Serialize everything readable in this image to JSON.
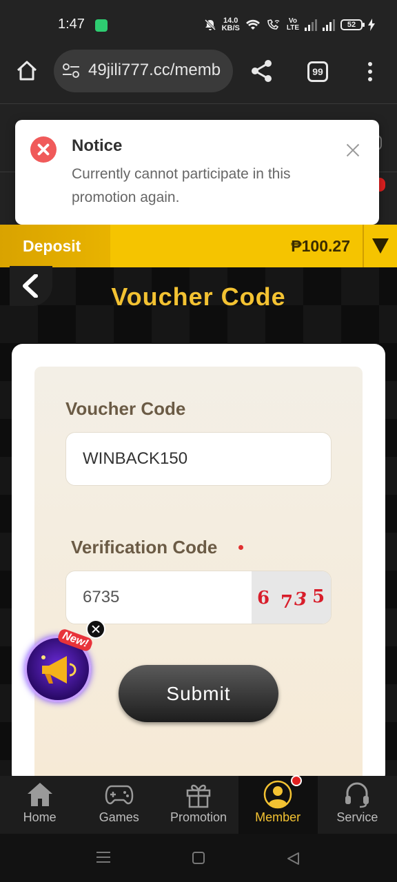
{
  "status_bar": {
    "time": "1:47",
    "net_speed_value": "14.0",
    "net_speed_unit": "KB/S",
    "volte_top": "Vo",
    "volte_bottom": "LTE",
    "battery": "52"
  },
  "browser": {
    "url": "49jili777.cc/memb",
    "tab_count": "99"
  },
  "notice": {
    "title": "Notice",
    "message": "Currently cannot participate in this promotion again."
  },
  "deposit_bar": {
    "deposit_label": "Deposit",
    "balance": "₱100.27"
  },
  "page": {
    "title": "Voucher Code"
  },
  "form": {
    "voucher_label": "Voucher Code",
    "voucher_value": "WINBACK150",
    "verification_label": "Verification Code",
    "verification_value": "6735",
    "captcha_chars": [
      "6",
      "7",
      "3",
      "5"
    ],
    "submit_label": "Submit"
  },
  "promo": {
    "badge": "New!"
  },
  "bottom_nav": {
    "items": [
      {
        "label": "Home",
        "icon": "home-icon"
      },
      {
        "label": "Games",
        "icon": "gamepad-icon"
      },
      {
        "label": "Promotion",
        "icon": "gift-icon"
      },
      {
        "label": "Member",
        "icon": "member-icon"
      },
      {
        "label": "Service",
        "icon": "headset-icon"
      }
    ],
    "active_index": 3
  },
  "colors": {
    "accent_gold": "#f3c232",
    "deposit_yellow": "#f5c400",
    "error_red": "#f05a5a"
  }
}
